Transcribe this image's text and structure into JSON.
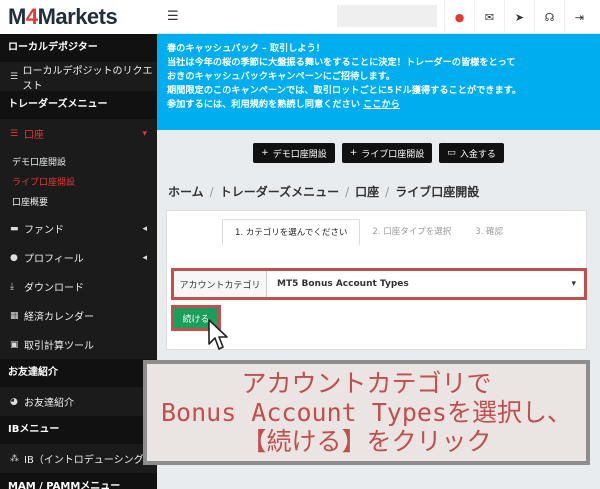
{
  "logo": {
    "text_m": "M",
    "text_4": "4",
    "text_rest": "Markets"
  },
  "topbar": {
    "menu_icon": "hamburger-icon",
    "icons": [
      "record-icon",
      "envelope-icon",
      "send-icon",
      "headset-icon",
      "logout-icon"
    ]
  },
  "sidebar": {
    "section_local": "ローカルデポジター",
    "local_item": "ローカルデポジットのリクエスト",
    "section_trader": "トレーダーズメニュー",
    "account": "口座",
    "sub_items": [
      "デモ口座開設",
      "ライブ口座開設",
      "口座概要"
    ],
    "items": [
      "ファンド",
      "プロフィール",
      "ダウンロード",
      "経済カレンダー",
      "取引計算ツール"
    ],
    "section_friend": "お友達紹介",
    "friend_item": "お友達紹介",
    "section_ib": "IBメニュー",
    "ib_item": "IB（イントロデューシング",
    "section_mam": "MAM / PAMMメニュー"
  },
  "banner": {
    "line1": "春のキャッシュバック – 取引しよう！",
    "line2": "当社は今年の桜の季節に大盤振る舞いをすることに決定！トレーダーの皆様をとって",
    "line3": "おきのキャッシュバックキャンペーンにご招待します。",
    "line4": "期間限定のこのキャンペーンでは、取引ロットごとに5ドル獲得することができます。",
    "line5": "参加するには、利用規約を熟読し同意ください",
    "link": "ここから"
  },
  "actions": {
    "demo": "デモ口座開設",
    "live": "ライブ口座開設",
    "deposit": "入金する"
  },
  "breadcrumb": {
    "home": "ホーム",
    "menu": "トレーダーズメニュー",
    "account": "口座",
    "live": "ライブ口座開設",
    "sep": "/"
  },
  "steps": [
    "1. カテゴリを選んでください",
    "2. 口座タイプを選択",
    "3. 確認"
  ],
  "form": {
    "label": "アカウントカテゴリ",
    "value": "MT5 Bonus Account Types",
    "continue": "続ける"
  },
  "callout": {
    "line1": "アカウントカテゴリで",
    "line2": "Bonus Account Typesを選択し、",
    "line3": "【続ける】をクリック"
  }
}
